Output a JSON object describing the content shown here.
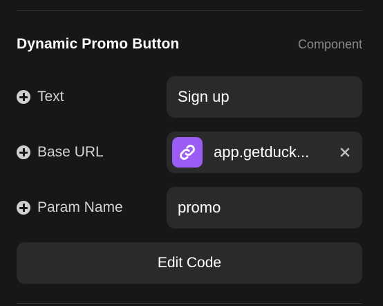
{
  "header": {
    "title": "Dynamic Promo Button",
    "type_label": "Component"
  },
  "properties": [
    {
      "label": "Text",
      "value": "Sign up"
    },
    {
      "label": "Base URL",
      "value": "app.getduck...",
      "icon": "link-icon"
    },
    {
      "label": "Param Name",
      "value": "promo"
    }
  ],
  "actions": {
    "edit_code_label": "Edit Code"
  },
  "colors": {
    "background": "#171717",
    "field": "#2a2a2a",
    "accent": "#9b5cf6",
    "muted": "#8a8a8a"
  }
}
